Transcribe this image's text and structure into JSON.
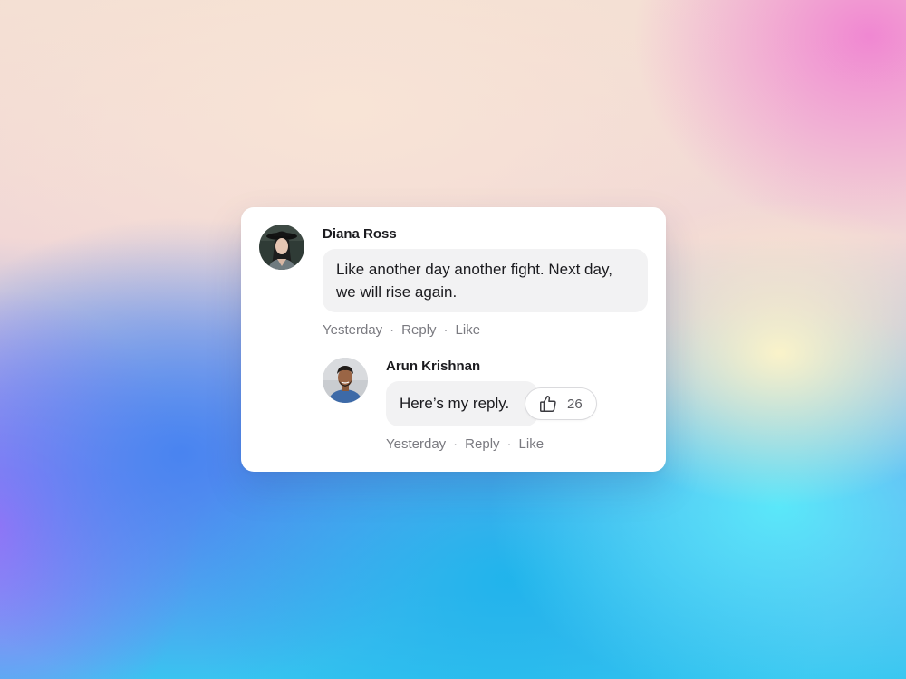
{
  "comment": {
    "author": "Diana Ross",
    "avatar_icon": "user-avatar-photo",
    "text": "Like another day another fight. Next day, we will rise again.",
    "time": "Yesterday",
    "reply_label": "Reply",
    "like_label": "Like",
    "separator": "·"
  },
  "reply": {
    "author": "Arun Krishnan",
    "avatar_icon": "user-avatar-photo",
    "text": "Here’s my reply.",
    "time": "Yesterday",
    "reply_label": "Reply",
    "like_label": "Like",
    "separator": "·",
    "reaction": {
      "icon": "thumbs-up-icon",
      "count": "26"
    }
  },
  "colors": {
    "card": "#ffffff",
    "bubble": "#f2f2f3",
    "text": "#1b1b1f",
    "meta": "#7a7a80"
  }
}
